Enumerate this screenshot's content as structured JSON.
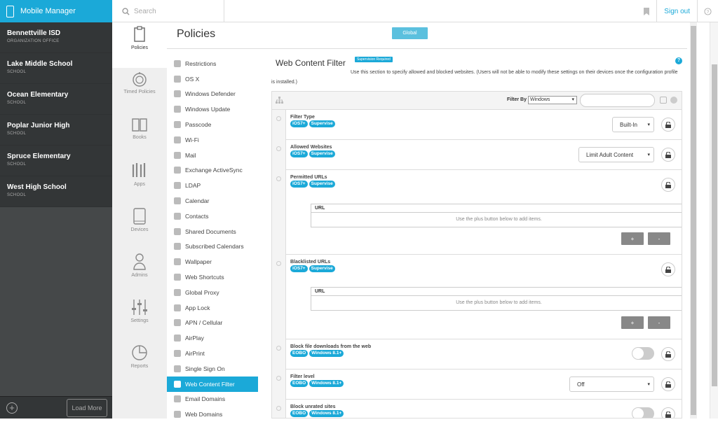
{
  "header": {
    "app_title": "Mobile Manager",
    "search_placeholder": "Search",
    "signout": "Sign out"
  },
  "sidebar": {
    "schools": [
      {
        "name": "Bennettville ISD",
        "type": "ORGANIZATION OFFICE"
      },
      {
        "name": "Lake Middle School",
        "type": "SCHOOL"
      },
      {
        "name": "Ocean Elementary",
        "type": "SCHOOL"
      },
      {
        "name": "Poplar Junior High",
        "type": "SCHOOL"
      },
      {
        "name": "Spruce Elementary",
        "type": "SCHOOL"
      },
      {
        "name": "West High School",
        "type": "SCHOOL"
      }
    ],
    "load_more": "Load More",
    "add_symbol": "+"
  },
  "nav": [
    {
      "label": "Policies",
      "icon": "policies-icon"
    },
    {
      "label": "Timed Policies",
      "icon": "timer-icon"
    },
    {
      "label": "Books",
      "icon": "book-icon"
    },
    {
      "label": "Apps",
      "icon": "apps-icon"
    },
    {
      "label": "Devices",
      "icon": "tablet-icon"
    },
    {
      "label": "Admins",
      "icon": "person-icon"
    },
    {
      "label": "Settings",
      "icon": "sliders-icon"
    },
    {
      "label": "Reports",
      "icon": "pie-icon"
    }
  ],
  "page": {
    "title": "Policies",
    "global_button": "Global"
  },
  "policies": [
    "Restrictions",
    "OS X",
    "Windows Defender",
    "Windows Update",
    "Passcode",
    "Wi-Fi",
    "Mail",
    "Exchange ActiveSync",
    "LDAP",
    "Calendar",
    "Contacts",
    "Shared Documents",
    "Subscribed Calendars",
    "Wallpaper",
    "Web Shortcuts",
    "Global Proxy",
    "App Lock",
    "APN / Cellular",
    "AirPlay",
    "AirPrint",
    "Single Sign On",
    "Web Content Filter",
    "Email Domains",
    "Web Domains"
  ],
  "active_policy": "Web Content Filter",
  "section": {
    "title": "Web Content Filter",
    "supervision_badge": "Supervision Required",
    "description": "Use this section to specify allowed and blocked websites. (Users will not be able to modify these settings on their devices once the configuration profile is installed.)",
    "help": "?"
  },
  "filter": {
    "label": "Filter By",
    "selected": "Windows"
  },
  "rows": {
    "filter_type": {
      "title": "Filter Type",
      "badges": [
        "iOS7+",
        "Supervise"
      ],
      "value": "Built-In"
    },
    "allowed_websites": {
      "title": "Allowed Websites",
      "badges": [
        "iOS7+",
        "Supervise"
      ],
      "value": "Limit Adult Content"
    },
    "permitted_urls": {
      "title": "Permitted URLs",
      "badges": [
        "iOS7+",
        "Supervise"
      ],
      "col": "URL",
      "empty": "Use the plus button below to add items.",
      "add": "+",
      "remove": "-"
    },
    "blacklisted_urls": {
      "title": "Blacklisted URLs",
      "badges": [
        "iOS7+",
        "Supervise"
      ],
      "col": "URL",
      "empty": "Use the plus button below to add items.",
      "add": "+",
      "remove": "-"
    },
    "block_downloads": {
      "title": "Block file downloads from the web",
      "badges": [
        "EOBO",
        "Windows 8.1+"
      ],
      "enabled": false
    },
    "filter_level": {
      "title": "Filter level",
      "badges": [
        "EOBO",
        "Windows 8.1+"
      ],
      "value": "Off"
    },
    "block_unrated": {
      "title": "Block unrated sites",
      "badges": [
        "EOBO",
        "Windows 8.1+"
      ],
      "enabled": false
    }
  },
  "colors": {
    "accent": "#1ba9d8",
    "sidebar": "#454849"
  }
}
